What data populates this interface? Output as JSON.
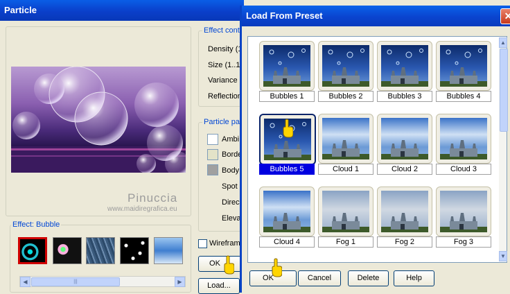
{
  "particle_window": {
    "title": "Particle",
    "effect_controls": {
      "group_label": "Effect cont",
      "labels": [
        "Density (1",
        "Size (1..1",
        "Variance",
        "Reflection"
      ]
    },
    "particle_params": {
      "group_label": "Particle pa",
      "labels": [
        "Ambi",
        "Borde",
        "Body",
        "Spot",
        "Direc",
        "Eleva"
      ],
      "swatch_colors": [
        "#ffffff",
        "#e3e3c8",
        "#a0a0a0"
      ]
    },
    "watermark": {
      "line1": "Pinuccia",
      "line2": "www.maidiregrafica.eu"
    },
    "effect_group_label": "Effect: Bubble",
    "wireframe_label": "Wireframe",
    "ok_label": "OK",
    "load_label": "Load...",
    "scroll_grip": "|||"
  },
  "preset_dialog": {
    "title": "Load From Preset",
    "close_glyph": "✕",
    "presets": [
      {
        "name": "Bubbles 1"
      },
      {
        "name": "Bubbles 2"
      },
      {
        "name": "Bubbles 3"
      },
      {
        "name": "Bubbles 4"
      },
      {
        "name": "Bubbles 5",
        "selected": true
      },
      {
        "name": "Cloud 1"
      },
      {
        "name": "Cloud 2"
      },
      {
        "name": "Cloud 3"
      },
      {
        "name": "Cloud 4"
      },
      {
        "name": "Fog 1"
      },
      {
        "name": "Fog 2"
      },
      {
        "name": "Fog 3"
      }
    ],
    "buttons": {
      "ok": "OK",
      "cancel": "Cancel",
      "delete": "Delete",
      "help": "Help"
    },
    "scroll_up": "▲",
    "scroll_down": "▼"
  },
  "colors": {
    "title_bar": "#0a44cf",
    "selection": "#0000e0",
    "accent_text": "#0046d5"
  }
}
